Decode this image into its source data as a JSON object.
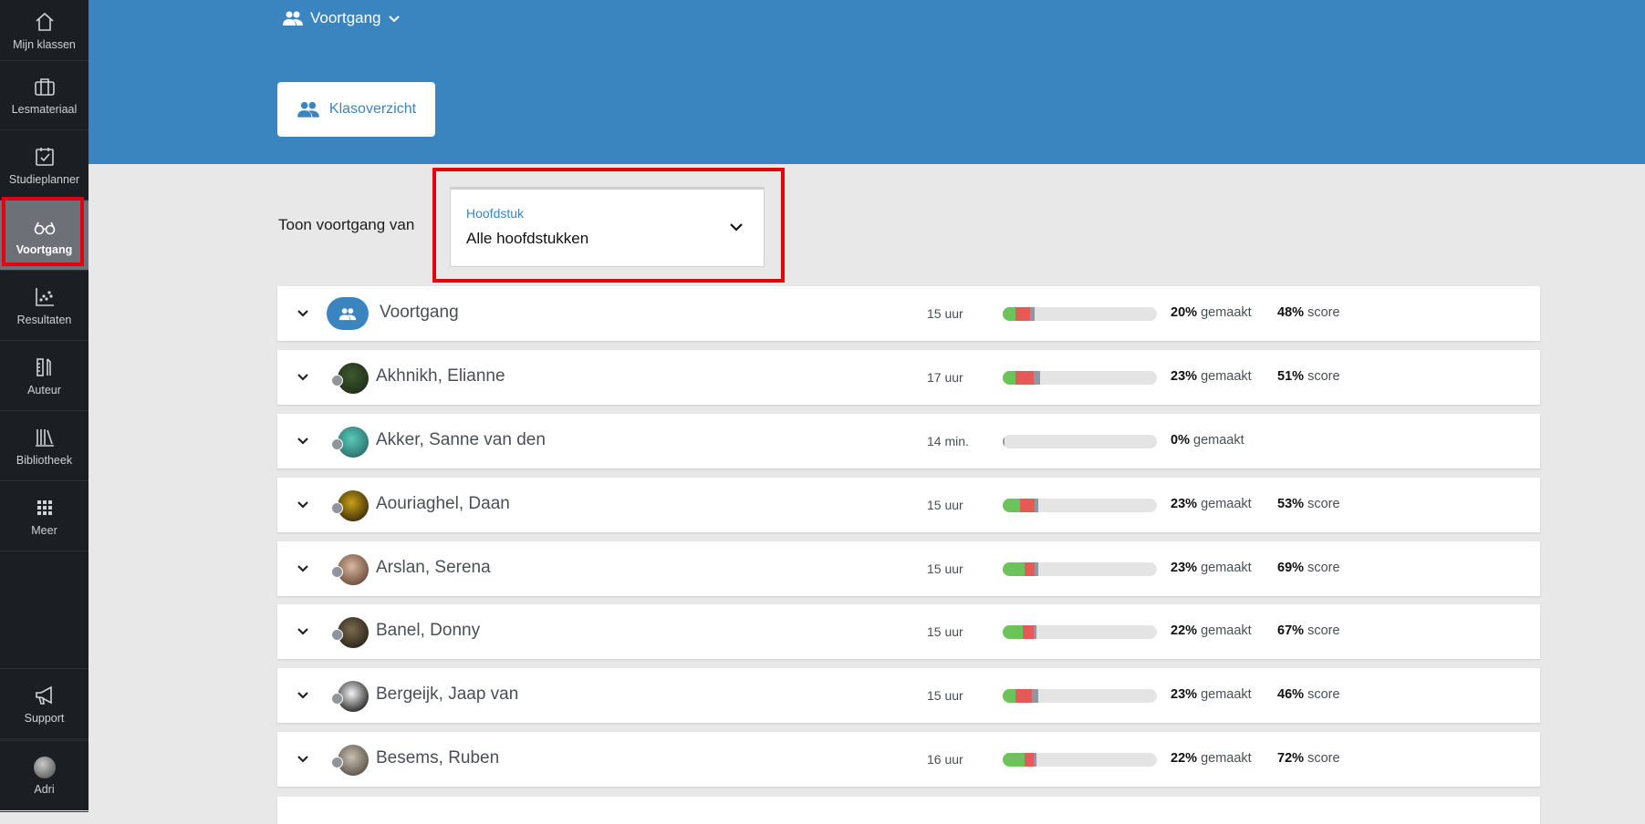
{
  "sidebar": {
    "items": [
      {
        "label": "Mijn klassen",
        "icon": "home-icon"
      },
      {
        "label": "Lesmateriaal",
        "icon": "briefcase-icon"
      },
      {
        "label": "Studieplanner",
        "icon": "calendar-check-icon"
      },
      {
        "label": "Voortgang",
        "icon": "glasses-icon",
        "active": true
      },
      {
        "label": "Resultaten",
        "icon": "scatter-chart-icon"
      },
      {
        "label": "Auteur",
        "icon": "author-tools-icon"
      },
      {
        "label": "Bibliotheek",
        "icon": "library-icon"
      },
      {
        "label": "Meer",
        "icon": "grid-icon"
      }
    ],
    "support": {
      "label": "Support",
      "icon": "megaphone-icon"
    },
    "user": {
      "label": "Adri",
      "icon": "user-avatar"
    }
  },
  "header": {
    "crumb": "Voortgang",
    "tab": "Klasoverzicht",
    "background": "#3a85c0"
  },
  "filter": {
    "label": "Toon voortgang van",
    "select_label": "Hoofdstuk",
    "select_value": "Alle hoofdstukken"
  },
  "labels": {
    "done_suffix": "gemaakt",
    "score_suffix": "score"
  },
  "rows": [
    {
      "name": "Voortgang",
      "group": true,
      "time": "15 uur",
      "done": "20%",
      "score": "48%",
      "bar": {
        "green": 0.08,
        "red": 0.1,
        "gray": 0.03
      }
    },
    {
      "name": "Akhnikh, Elianne",
      "time": "17 uur",
      "done": "23%",
      "score": "51%",
      "bar": {
        "green": 0.08,
        "red": 0.12,
        "gray": 0.04
      }
    },
    {
      "name": "Akker, Sanne van den",
      "time": "14 min.",
      "done": "0%",
      "score": "",
      "bar": {
        "green": 0.0,
        "red": 0.0,
        "gray": 0.01
      }
    },
    {
      "name": "Aouriaghel, Daan",
      "time": "15 uur",
      "done": "23%",
      "score": "53%",
      "bar": {
        "green": 0.11,
        "red": 0.1,
        "gray": 0.02
      }
    },
    {
      "name": "Arslan, Serena",
      "time": "15 uur",
      "done": "23%",
      "score": "69%",
      "bar": {
        "green": 0.14,
        "red": 0.07,
        "gray": 0.02
      }
    },
    {
      "name": "Banel, Donny",
      "time": "15 uur",
      "done": "22%",
      "score": "67%",
      "bar": {
        "green": 0.13,
        "red": 0.07,
        "gray": 0.02
      }
    },
    {
      "name": "Bergeijk, Jaap van",
      "time": "15 uur",
      "done": "23%",
      "score": "46%",
      "bar": {
        "green": 0.08,
        "red": 0.11,
        "gray": 0.04
      }
    },
    {
      "name": "Besems, Ruben",
      "time": "16 uur",
      "done": "22%",
      "score": "72%",
      "bar": {
        "green": 0.14,
        "red": 0.06,
        "gray": 0.02
      }
    }
  ]
}
